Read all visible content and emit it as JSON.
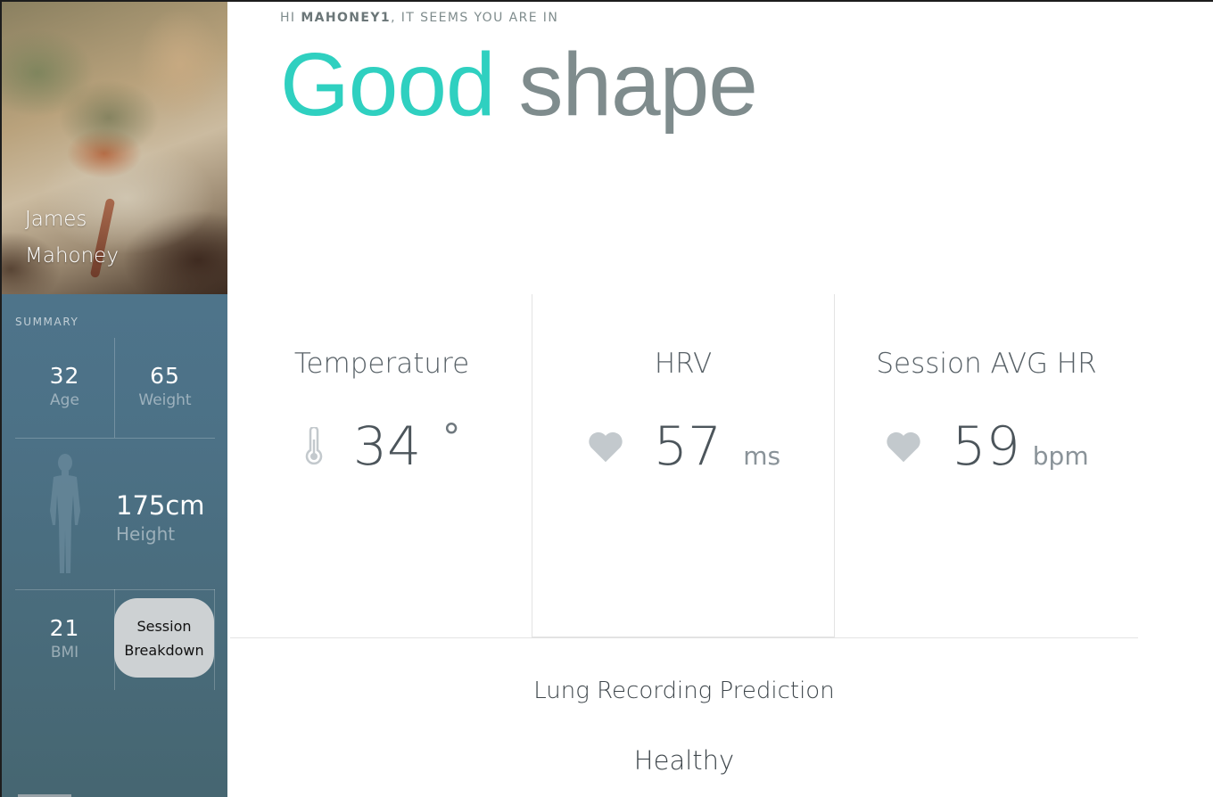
{
  "profile": {
    "first_name": "James",
    "last_name": "Mahoney"
  },
  "summary": {
    "label": "SUMMARY",
    "age": {
      "value": "32",
      "label": "Age"
    },
    "weight": {
      "value": "65",
      "label": "Weight"
    },
    "height": {
      "value": "175cm",
      "label": "Height"
    },
    "bmi": {
      "value": "21",
      "label": "BMI"
    },
    "session_button": {
      "line1": "Session",
      "line2": "Breakdown"
    }
  },
  "greeting": {
    "prefix": "HI ",
    "username": "MAHONEY1",
    "suffix": ", IT SEEMS YOU ARE IN"
  },
  "headline": {
    "word1": "Good",
    "word2": "shape",
    "word1_color": "#2fd0c0",
    "word2_color": "#7f8c8d"
  },
  "metrics": [
    {
      "title": "Temperature",
      "value": "34",
      "unit": "°",
      "icon": "thermometer-icon"
    },
    {
      "title": "HRV",
      "value": "57",
      "unit": "ms",
      "icon": "heart-icon"
    },
    {
      "title": "Session AVG HR",
      "value": "59",
      "unit": "bpm",
      "icon": "heart-icon"
    }
  ],
  "lung": {
    "title": "Lung Recording Prediction",
    "value": "Healthy"
  }
}
